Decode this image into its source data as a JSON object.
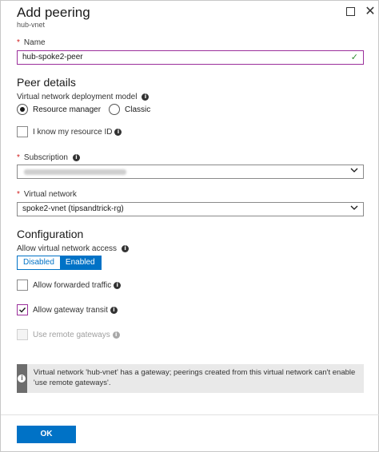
{
  "header": {
    "title": "Add peering",
    "subtitle": "hub-vnet"
  },
  "name_field": {
    "label": "Name",
    "value": "hub-spoke2-peer"
  },
  "peer_details": {
    "heading": "Peer details",
    "deployment_model_label": "Virtual network deployment model",
    "options": [
      "Resource manager",
      "Classic"
    ],
    "selected": "Resource manager",
    "resource_id_label": "I know my resource ID",
    "subscription_label": "Subscription",
    "virtual_network_label": "Virtual network",
    "virtual_network_value": "spoke2-vnet (tipsandtrick-rg)"
  },
  "configuration": {
    "heading": "Configuration",
    "access_label": "Allow virtual network access",
    "toggle_off": "Disabled",
    "toggle_on": "Enabled",
    "allow_forwarded": "Allow forwarded traffic",
    "allow_gateway": "Allow gateway transit",
    "use_remote": "Use remote gateways"
  },
  "info_message": "Virtual network 'hub-vnet' has a gateway; peerings created from this virtual network can't enable 'use remote gateways'.",
  "ok_label": "OK",
  "colors": {
    "accent": "#0072c6",
    "focus": "#9b2f9b",
    "required": "#d01b1b",
    "valid": "#2e8b2e"
  }
}
